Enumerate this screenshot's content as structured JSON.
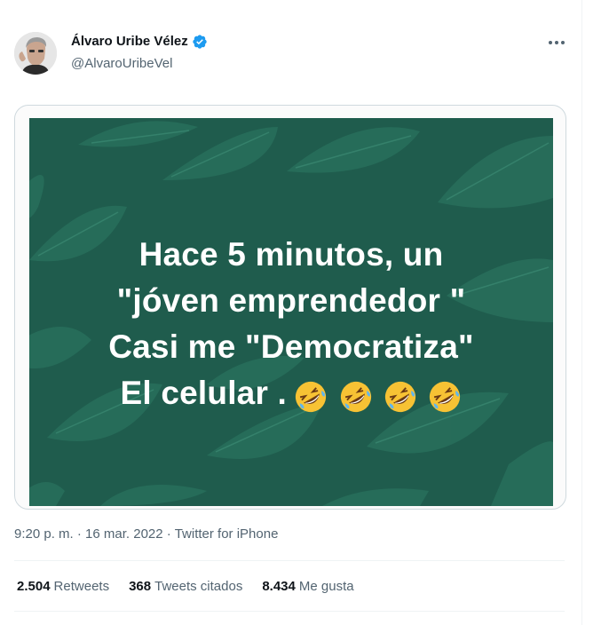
{
  "author": {
    "display_name": "Álvaro Uribe Vélez",
    "handle": "@AlvaroUribeVel",
    "verified": true
  },
  "media": {
    "lines": [
      "Hace 5 minutos, un",
      "\"jóven emprendedor \"",
      "Casi me \"Democratiza\"",
      "El celular ."
    ],
    "emoji": "rolling-on-the-floor-laughing",
    "emoji_count": 4,
    "background_color": "#1f5c4d",
    "leaf_color": "#2d7a64"
  },
  "meta": {
    "time": "9:20 p. m.",
    "date": "16 mar. 2022",
    "source": "Twitter for iPhone",
    "separator": "·"
  },
  "stats": [
    {
      "count": "2.504",
      "label": "Retweets"
    },
    {
      "count": "368",
      "label": "Tweets citados"
    },
    {
      "count": "8.434",
      "label": "Me gusta"
    }
  ],
  "colors": {
    "text_primary": "#0f1419",
    "text_secondary": "#536471",
    "verified_blue": "#1d9bf0",
    "divider": "#eff3f4"
  }
}
